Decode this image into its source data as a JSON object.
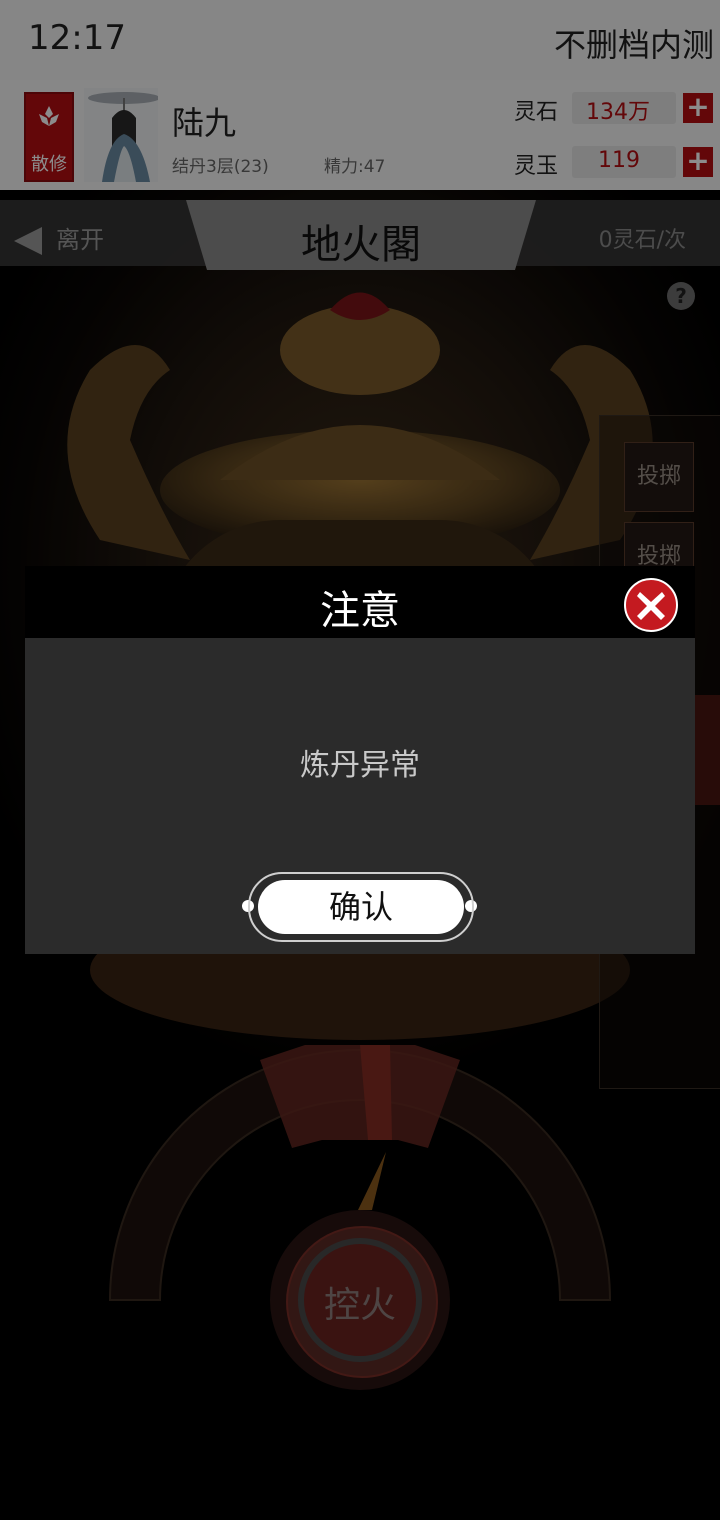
{
  "status": {
    "time": "12:17",
    "right_text": "不删档内测"
  },
  "player": {
    "badge_label": "散修",
    "name": "陆九",
    "realm": "结丹3层(23)",
    "stamina": "精力:47",
    "resources": [
      {
        "label": "灵石",
        "value": "134万"
      },
      {
        "label": "灵玉",
        "value": "119"
      }
    ],
    "plus_symbol": "+"
  },
  "location": {
    "title": "地火閣",
    "leave_label": "离开",
    "cost_label": "0灵石/次",
    "help_symbol": "?"
  },
  "side_buttons": [
    {
      "label": "投掷"
    },
    {
      "label": "投掷"
    }
  ],
  "fire_button": {
    "label": "控火"
  },
  "modal": {
    "title": "注意",
    "message": "炼丹异常",
    "confirm_label": "确认"
  },
  "colors": {
    "accent_red": "#b40d12",
    "modal_bg": "#2b2b2b",
    "header_bg": "#f6f6f6"
  }
}
